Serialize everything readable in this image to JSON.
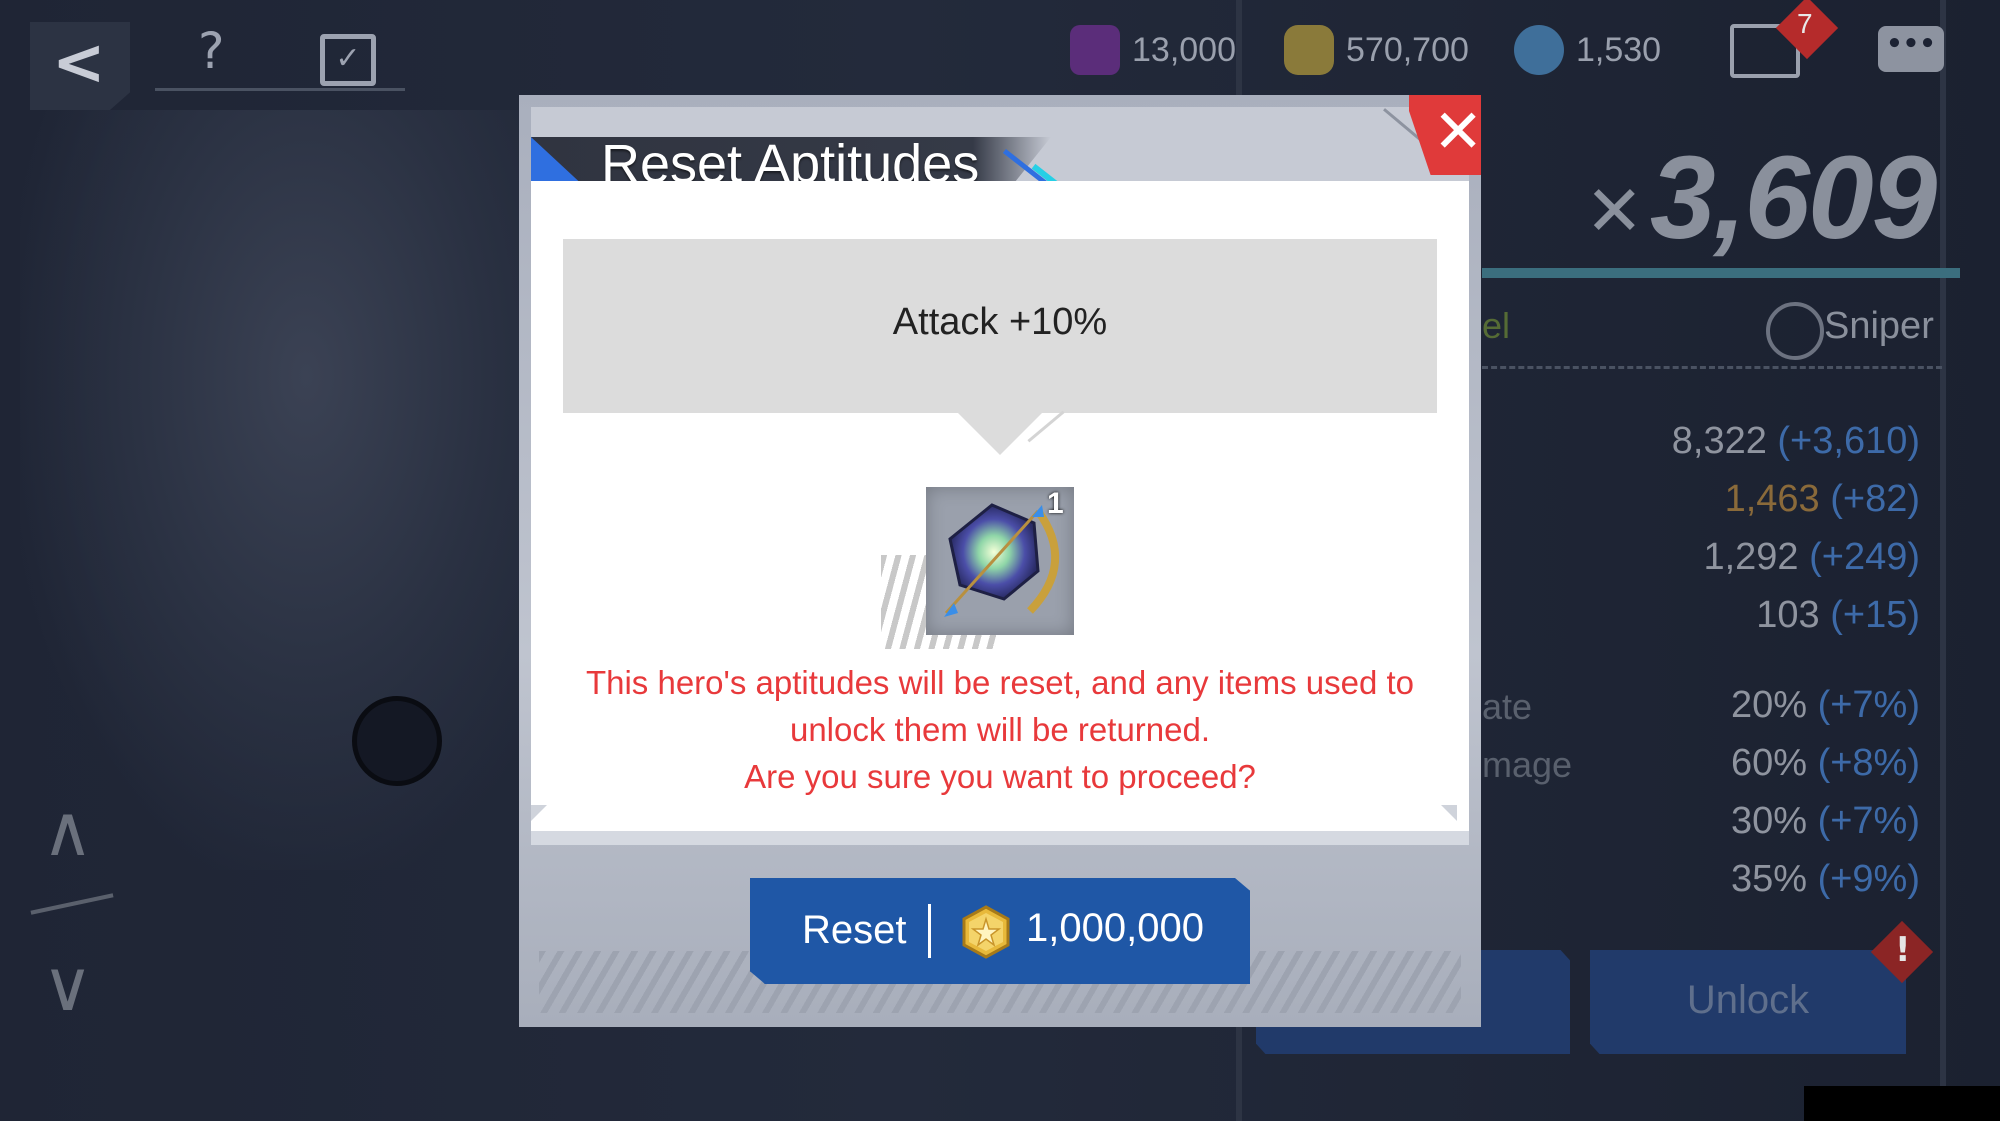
{
  "topbar": {
    "back_icon": "back-arrow-icon",
    "help_label": "?",
    "calendar_icon": "calendar-check-icon"
  },
  "resources": [
    {
      "icon": "crest-icon",
      "value": "13,000",
      "color": "#5b2d7a"
    },
    {
      "icon": "gold-coin-icon",
      "value": "570,700",
      "color": "#8a7a3a"
    },
    {
      "icon": "crystal-icon",
      "value": "1,530",
      "color": "#3f6f9a"
    }
  ],
  "mail": {
    "icon": "mail-icon",
    "badge": "7"
  },
  "chat_icon": "chat-icon",
  "hero": {
    "power": "3,609",
    "class_label": "Sniper",
    "tab_fragment": "el",
    "stats": [
      {
        "label": "",
        "value": "8,322",
        "bonus": "(+3,610)",
        "value_color": "#8f949f"
      },
      {
        "label": "",
        "value": "1,463",
        "bonus": "(+82)",
        "value_color": "#8a6a3a"
      },
      {
        "label": "",
        "value": "1,292",
        "bonus": "(+249)",
        "value_color": "#8f949f"
      },
      {
        "label": "",
        "value": "103",
        "bonus": "(+15)",
        "value_color": "#8f949f"
      },
      {
        "label": "ate",
        "value": "20%",
        "bonus": "(+7%)",
        "value_color": "#8f949f"
      },
      {
        "label": "mage",
        "value": "60%",
        "bonus": "(+8%)",
        "value_color": "#8f949f"
      },
      {
        "label": "",
        "value": "30%",
        "bonus": "(+7%)",
        "value_color": "#8f949f"
      },
      {
        "label": "",
        "value": "35%",
        "bonus": "(+9%)",
        "value_color": "#8f949f"
      }
    ],
    "unlock_label": "Unlock"
  },
  "modal": {
    "title": "Reset Aptitudes",
    "close_icon": "close-icon",
    "aptitude": "Attack +10%",
    "item": {
      "icon": "aptitude-gem-icon",
      "count": "1"
    },
    "warning_line1": "This hero's aptitudes will be reset, and any items used to",
    "warning_line2": "unlock them will be returned.",
    "warning_line3": "Are you sure you want to proceed?",
    "reset_label": "Reset",
    "cost_icon": "gold-coin-icon",
    "cost": "1,000,000",
    "accent": "#e03a3a",
    "button_color": "#1f57a6"
  }
}
